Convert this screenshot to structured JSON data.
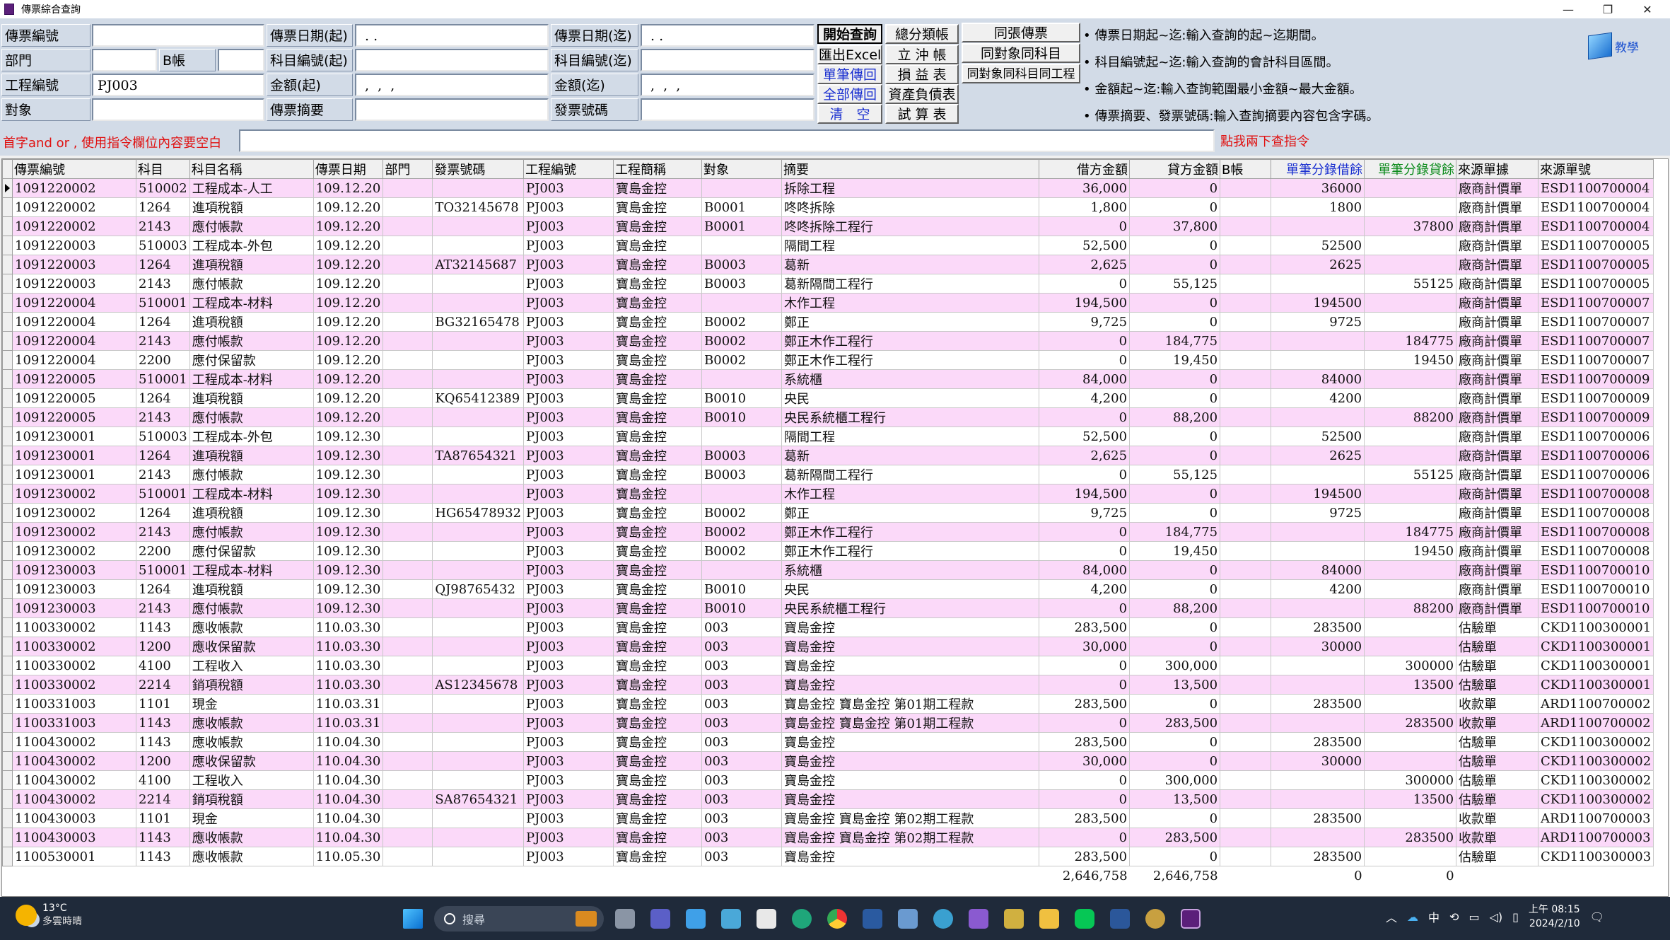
{
  "window": {
    "title": "傳票綜合查詢",
    "minimize": "—",
    "restore": "❐",
    "close": "✕"
  },
  "form": {
    "labels": {
      "voucher_no": "傳票編號",
      "voucher_date_from": "傳票日期(起)",
      "voucher_date_to": "傳票日期(迄)",
      "dept": "部門",
      "b_book": "B帳",
      "account_from": "科目編號(起)",
      "account_to": "科目編號(迄)",
      "project_no": "工程編號",
      "amount_from": "金額(起)",
      "amount_to": "金額(迄)",
      "target": "對象",
      "voucher_summary": "傳票摘要",
      "invoice_no": "發票號碼"
    },
    "values": {
      "voucher_no": "",
      "voucher_date_from": " . .",
      "voucher_date_to": " . .",
      "dept": "",
      "b_book": "",
      "account_from": "",
      "account_to": "",
      "project_no": "PJ003",
      "amount_from": " ,  ,  ,",
      "amount_to": " ,  ,  ,",
      "target": "",
      "voucher_summary": "",
      "invoice_no": ""
    }
  },
  "buttons": {
    "start_query": "開始查詢",
    "export_excel": "匯出Excel",
    "single_return": "單筆傳回",
    "all_return": "全部傳回",
    "clear": "清　空",
    "general_ledger": "總分類帳",
    "offset_account": "立 沖 帳",
    "income_statement": "損 益 表",
    "balance_sheet": "資產負債表",
    "trial_balance": "試 算 表",
    "same_voucher": "同張傳票",
    "same_target_account": "同對象同科目",
    "same_target_account_project": "同對象同科目同工程"
  },
  "notes": [
    "• 傳票日期起~迄:輸入查詢的起~迄期間。",
    "• 科目編號起~迄:輸入查詢的會計科目區間。",
    "• 金額起~迄:輸入查詢範圍最小金額~最大金額。",
    "• 傳票摘要、發票號碼:輸入查詢摘要內容包含字碼。"
  ],
  "teach_label": "教學",
  "command": {
    "label": "首字and or , 使用指令欄位內容要空白",
    "hint": "點我兩下查指令",
    "value": ""
  },
  "table": {
    "columns": [
      "傳票編號",
      "科目",
      "科目名稱",
      "傳票日期",
      "部門",
      "發票號碼",
      "工程編號",
      "工程簡稱",
      "對象",
      "摘要",
      "借方金額",
      "貸方金額",
      "B帳",
      "單筆分錄借餘",
      "單筆分錄貸餘",
      "來源單據",
      "來源單號"
    ],
    "rows": [
      [
        "1091220002",
        "510002",
        "工程成本-人工",
        "109.12.20",
        "",
        "",
        "PJ003",
        "寶島金控",
        "",
        "拆除工程",
        "36,000",
        "0",
        "",
        "36000",
        "",
        "廠商計價單",
        "ESD1100700004"
      ],
      [
        "1091220002",
        "1264",
        "進項稅額",
        "109.12.20",
        "",
        "TO32145678",
        "PJ003",
        "寶島金控",
        "B0001",
        "咚咚拆除",
        "1,800",
        "0",
        "",
        "1800",
        "",
        "廠商計價單",
        "ESD1100700004"
      ],
      [
        "1091220002",
        "2143",
        "應付帳款",
        "109.12.20",
        "",
        "",
        "PJ003",
        "寶島金控",
        "B0001",
        "咚咚拆除工程行",
        "0",
        "37,800",
        "",
        "",
        "37800",
        "廠商計價單",
        "ESD1100700004"
      ],
      [
        "1091220003",
        "510003",
        "工程成本-外包",
        "109.12.20",
        "",
        "",
        "PJ003",
        "寶島金控",
        "",
        "隔間工程",
        "52,500",
        "0",
        "",
        "52500",
        "",
        "廠商計價單",
        "ESD1100700005"
      ],
      [
        "1091220003",
        "1264",
        "進項稅額",
        "109.12.20",
        "",
        "AT32145687",
        "PJ003",
        "寶島金控",
        "B0003",
        "葛新",
        "2,625",
        "0",
        "",
        "2625",
        "",
        "廠商計價單",
        "ESD1100700005"
      ],
      [
        "1091220003",
        "2143",
        "應付帳款",
        "109.12.20",
        "",
        "",
        "PJ003",
        "寶島金控",
        "B0003",
        "葛新隔間工程行",
        "0",
        "55,125",
        "",
        "",
        "55125",
        "廠商計價單",
        "ESD1100700005"
      ],
      [
        "1091220004",
        "510001",
        "工程成本-材料",
        "109.12.20",
        "",
        "",
        "PJ003",
        "寶島金控",
        "",
        "木作工程",
        "194,500",
        "0",
        "",
        "194500",
        "",
        "廠商計價單",
        "ESD1100700007"
      ],
      [
        "1091220004",
        "1264",
        "進項稅額",
        "109.12.20",
        "",
        "BG32165478",
        "PJ003",
        "寶島金控",
        "B0002",
        "鄭正",
        "9,725",
        "0",
        "",
        "9725",
        "",
        "廠商計價單",
        "ESD1100700007"
      ],
      [
        "1091220004",
        "2143",
        "應付帳款",
        "109.12.20",
        "",
        "",
        "PJ003",
        "寶島金控",
        "B0002",
        "鄭正木作工程行",
        "0",
        "184,775",
        "",
        "",
        "184775",
        "廠商計價單",
        "ESD1100700007"
      ],
      [
        "1091220004",
        "2200",
        "應付保留款",
        "109.12.20",
        "",
        "",
        "PJ003",
        "寶島金控",
        "B0002",
        "鄭正木作工程行",
        "0",
        "19,450",
        "",
        "",
        "19450",
        "廠商計價單",
        "ESD1100700007"
      ],
      [
        "1091220005",
        "510001",
        "工程成本-材料",
        "109.12.20",
        "",
        "",
        "PJ003",
        "寶島金控",
        "",
        "系統櫃",
        "84,000",
        "0",
        "",
        "84000",
        "",
        "廠商計價單",
        "ESD1100700009"
      ],
      [
        "1091220005",
        "1264",
        "進項稅額",
        "109.12.20",
        "",
        "KQ65412389",
        "PJ003",
        "寶島金控",
        "B0010",
        "央民",
        "4,200",
        "0",
        "",
        "4200",
        "",
        "廠商計價單",
        "ESD1100700009"
      ],
      [
        "1091220005",
        "2143",
        "應付帳款",
        "109.12.20",
        "",
        "",
        "PJ003",
        "寶島金控",
        "B0010",
        "央民系統櫃工程行",
        "0",
        "88,200",
        "",
        "",
        "88200",
        "廠商計價單",
        "ESD1100700009"
      ],
      [
        "1091230001",
        "510003",
        "工程成本-外包",
        "109.12.30",
        "",
        "",
        "PJ003",
        "寶島金控",
        "",
        "隔間工程",
        "52,500",
        "0",
        "",
        "52500",
        "",
        "廠商計價單",
        "ESD1100700006"
      ],
      [
        "1091230001",
        "1264",
        "進項稅額",
        "109.12.30",
        "",
        "TA87654321",
        "PJ003",
        "寶島金控",
        "B0003",
        "葛新",
        "2,625",
        "0",
        "",
        "2625",
        "",
        "廠商計價單",
        "ESD1100700006"
      ],
      [
        "1091230001",
        "2143",
        "應付帳款",
        "109.12.30",
        "",
        "",
        "PJ003",
        "寶島金控",
        "B0003",
        "葛新隔間工程行",
        "0",
        "55,125",
        "",
        "",
        "55125",
        "廠商計價單",
        "ESD1100700006"
      ],
      [
        "1091230002",
        "510001",
        "工程成本-材料",
        "109.12.30",
        "",
        "",
        "PJ003",
        "寶島金控",
        "",
        "木作工程",
        "194,500",
        "0",
        "",
        "194500",
        "",
        "廠商計價單",
        "ESD1100700008"
      ],
      [
        "1091230002",
        "1264",
        "進項稅額",
        "109.12.30",
        "",
        "HG65478932",
        "PJ003",
        "寶島金控",
        "B0002",
        "鄭正",
        "9,725",
        "0",
        "",
        "9725",
        "",
        "廠商計價單",
        "ESD1100700008"
      ],
      [
        "1091230002",
        "2143",
        "應付帳款",
        "109.12.30",
        "",
        "",
        "PJ003",
        "寶島金控",
        "B0002",
        "鄭正木作工程行",
        "0",
        "184,775",
        "",
        "",
        "184775",
        "廠商計價單",
        "ESD1100700008"
      ],
      [
        "1091230002",
        "2200",
        "應付保留款",
        "109.12.30",
        "",
        "",
        "PJ003",
        "寶島金控",
        "B0002",
        "鄭正木作工程行",
        "0",
        "19,450",
        "",
        "",
        "19450",
        "廠商計價單",
        "ESD1100700008"
      ],
      [
        "1091230003",
        "510001",
        "工程成本-材料",
        "109.12.30",
        "",
        "",
        "PJ003",
        "寶島金控",
        "",
        "系統櫃",
        "84,000",
        "0",
        "",
        "84000",
        "",
        "廠商計價單",
        "ESD1100700010"
      ],
      [
        "1091230003",
        "1264",
        "進項稅額",
        "109.12.30",
        "",
        "QJ98765432",
        "PJ003",
        "寶島金控",
        "B0010",
        "央民",
        "4,200",
        "0",
        "",
        "4200",
        "",
        "廠商計價單",
        "ESD1100700010"
      ],
      [
        "1091230003",
        "2143",
        "應付帳款",
        "109.12.30",
        "",
        "",
        "PJ003",
        "寶島金控",
        "B0010",
        "央民系統櫃工程行",
        "0",
        "88,200",
        "",
        "",
        "88200",
        "廠商計價單",
        "ESD1100700010"
      ],
      [
        "1100330002",
        "1143",
        "應收帳款",
        "110.03.30",
        "",
        "",
        "PJ003",
        "寶島金控",
        "003",
        "寶島金控",
        "283,500",
        "0",
        "",
        "283500",
        "",
        "估驗單",
        "CKD1100300001"
      ],
      [
        "1100330002",
        "1200",
        "應收保留款",
        "110.03.30",
        "",
        "",
        "PJ003",
        "寶島金控",
        "003",
        "寶島金控",
        "30,000",
        "0",
        "",
        "30000",
        "",
        "估驗單",
        "CKD1100300001"
      ],
      [
        "1100330002",
        "4100",
        "工程收入",
        "110.03.30",
        "",
        "",
        "PJ003",
        "寶島金控",
        "003",
        "寶島金控",
        "0",
        "300,000",
        "",
        "",
        "300000",
        "估驗單",
        "CKD1100300001"
      ],
      [
        "1100330002",
        "2214",
        "銷項稅額",
        "110.03.30",
        "",
        "AS12345678",
        "PJ003",
        "寶島金控",
        "003",
        "寶島金控",
        "0",
        "13,500",
        "",
        "",
        "13500",
        "估驗單",
        "CKD1100300001"
      ],
      [
        "1100331003",
        "1101",
        "現金",
        "110.03.31",
        "",
        "",
        "PJ003",
        "寶島金控",
        "003",
        "寶島金控 寶島金控 第01期工程款",
        "283,500",
        "0",
        "",
        "283500",
        "",
        "收款單",
        "ARD1100700002"
      ],
      [
        "1100331003",
        "1143",
        "應收帳款",
        "110.03.31",
        "",
        "",
        "PJ003",
        "寶島金控",
        "003",
        "寶島金控 寶島金控 第01期工程款",
        "0",
        "283,500",
        "",
        "",
        "283500",
        "收款單",
        "ARD1100700002"
      ],
      [
        "1100430002",
        "1143",
        "應收帳款",
        "110.04.30",
        "",
        "",
        "PJ003",
        "寶島金控",
        "003",
        "寶島金控",
        "283,500",
        "0",
        "",
        "283500",
        "",
        "估驗單",
        "CKD1100300002"
      ],
      [
        "1100430002",
        "1200",
        "應收保留款",
        "110.04.30",
        "",
        "",
        "PJ003",
        "寶島金控",
        "003",
        "寶島金控",
        "30,000",
        "0",
        "",
        "30000",
        "",
        "估驗單",
        "CKD1100300002"
      ],
      [
        "1100430002",
        "4100",
        "工程收入",
        "110.04.30",
        "",
        "",
        "PJ003",
        "寶島金控",
        "003",
        "寶島金控",
        "0",
        "300,000",
        "",
        "",
        "300000",
        "估驗單",
        "CKD1100300002"
      ],
      [
        "1100430002",
        "2214",
        "銷項稅額",
        "110.04.30",
        "",
        "SA87654321",
        "PJ003",
        "寶島金控",
        "003",
        "寶島金控",
        "0",
        "13,500",
        "",
        "",
        "13500",
        "估驗單",
        "CKD1100300002"
      ],
      [
        "1100430003",
        "1101",
        "現金",
        "110.04.30",
        "",
        "",
        "PJ003",
        "寶島金控",
        "003",
        "寶島金控 寶島金控 第02期工程款",
        "283,500",
        "0",
        "",
        "283500",
        "",
        "收款單",
        "ARD1100700003"
      ],
      [
        "1100430003",
        "1143",
        "應收帳款",
        "110.04.30",
        "",
        "",
        "PJ003",
        "寶島金控",
        "003",
        "寶島金控 寶島金控 第02期工程款",
        "0",
        "283,500",
        "",
        "",
        "283500",
        "收款單",
        "ARD1100700003"
      ],
      [
        "1100530001",
        "1143",
        "應收帳款",
        "110.05.30",
        "",
        "",
        "PJ003",
        "寶島金控",
        "003",
        "寶島金控",
        "283,500",
        "0",
        "",
        "283500",
        "",
        "估驗單",
        "CKD1100300003"
      ]
    ],
    "totals": {
      "debit": "2,646,758",
      "credit": "2,646,758",
      "single_debit": "0",
      "single_credit": "0"
    }
  },
  "taskbar": {
    "weather_temp": "13°C",
    "weather_desc": "多雲時晴",
    "search_placeholder": "搜尋",
    "ime": "中",
    "time": "上午 08:15",
    "date": "2024/2/10"
  },
  "colors": {
    "row_pink": "#fbd9f9",
    "form_bg": "#d2dbe7",
    "accent_red": "#e01010",
    "accent_blue": "#1a2fd0",
    "accent_green": "#0a8a1a"
  }
}
